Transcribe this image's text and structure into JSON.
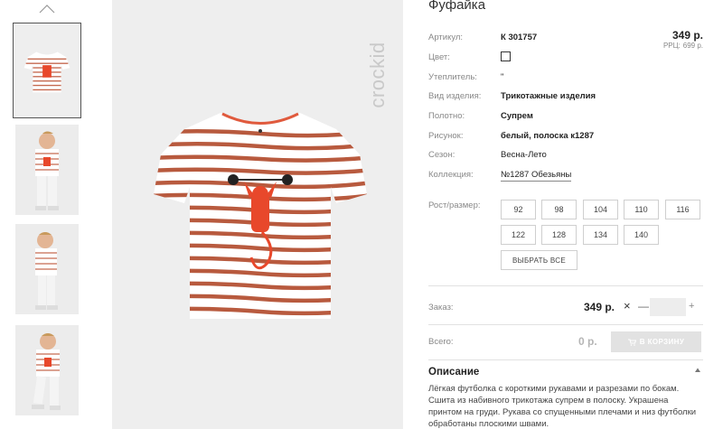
{
  "product": {
    "title": "Фуфайка",
    "price": "349 р.",
    "rrp_label": "РРЦ:",
    "rrp_value": "699 р."
  },
  "brand": {
    "name": "crockid"
  },
  "colors": {
    "stripe": "#b85a3e",
    "print": "#e8482b",
    "neck": "#e05a3d",
    "background": "#eeeeee"
  },
  "attributes": [
    {
      "label": "Артикул:",
      "value": "К 301757"
    },
    {
      "label": "Цвет:",
      "value": ""
    },
    {
      "label": "Утеплитель:",
      "value": "\""
    },
    {
      "label": "Вид изделия:",
      "value": "Трикотажные изделия"
    },
    {
      "label": "Полотно:",
      "value": "Супрем"
    },
    {
      "label": "Рисунок:",
      "value": "белый, полоска к1287"
    },
    {
      "label": "Сезон:",
      "value": "Весна-Лето"
    },
    {
      "label": "Коллекция:",
      "value": "№1287 Обезьяны"
    }
  ],
  "sizes": {
    "label": "Рост/размер:",
    "options": [
      "92",
      "98",
      "104",
      "110",
      "116",
      "122",
      "128",
      "134",
      "140"
    ],
    "select_all": "ВЫБРАТЬ ВСЕ"
  },
  "order": {
    "label": "Заказ:",
    "price": "349 р.",
    "remove": "×",
    "minus": "—",
    "plus": "+",
    "quantity": ""
  },
  "total": {
    "label": "Всего:",
    "value": "0 р.",
    "cart_button": "В КОРЗИНУ"
  },
  "description": {
    "title": "Описание",
    "text": "Лёгкая футболка с короткими рукавами и разрезами по бокам. Сшита из набивного трикотажа супрем в полоску. Украшена принтом на груди. Рукава со спущенными плечами и низ футболки обработаны плоскими швами."
  },
  "icons": {
    "thumbs_up": "chevron-up-icon",
    "desc_toggle": "triangle-up-icon",
    "cart": "cart-icon"
  }
}
